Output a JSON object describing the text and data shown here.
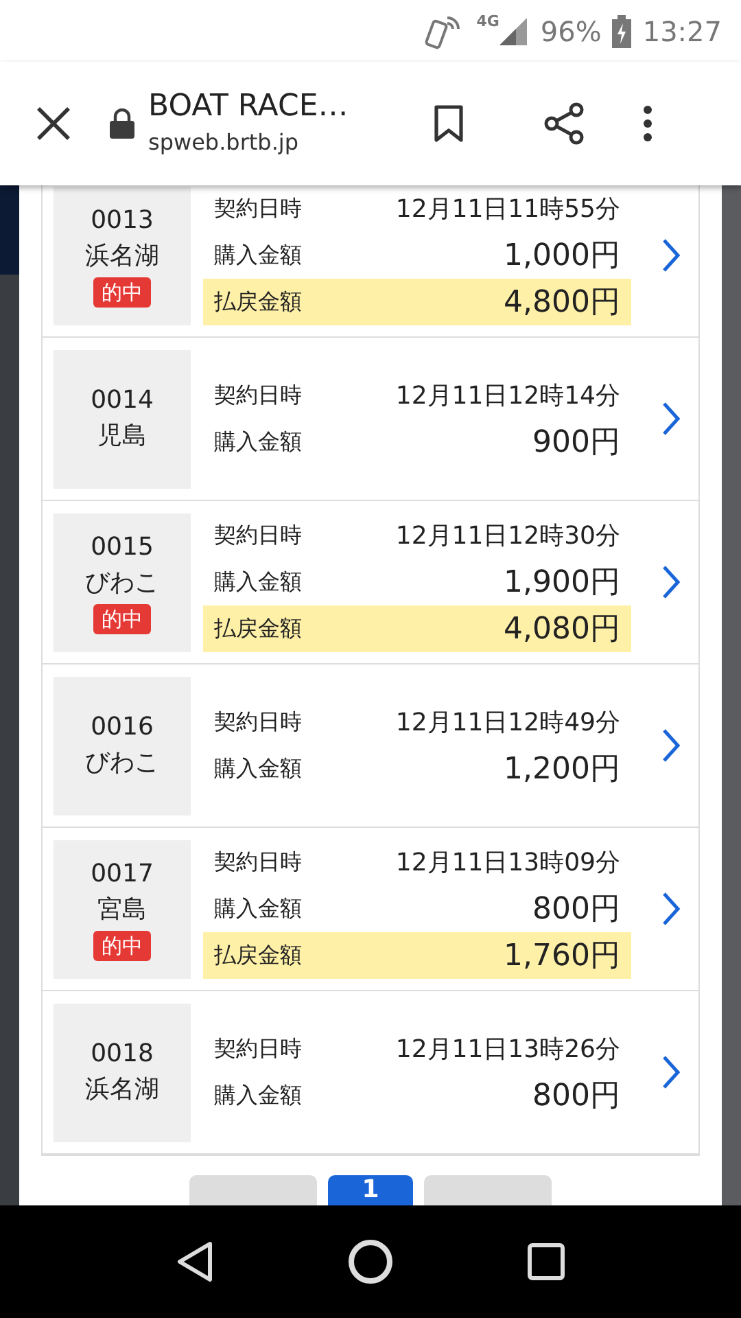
{
  "status_bar": {
    "network": "4G",
    "battery": "96%",
    "time": "13:27"
  },
  "toolbar": {
    "title": "BOAT RACE…",
    "url": "spweb.brtb.jp"
  },
  "tickets": [
    {
      "number": "0013",
      "venue": "浜名湖",
      "badge": "的中",
      "rows": [
        {
          "label": "契約日時",
          "value": "12月11日11時55分",
          "highlighted": false
        },
        {
          "label": "購入金額",
          "value": "1,000円",
          "highlighted": false
        },
        {
          "label": "払戻金額",
          "value": "4,800円",
          "highlighted": true
        }
      ]
    },
    {
      "number": "0014",
      "venue": "児島",
      "rows": [
        {
          "label": "契約日時",
          "value": "12月11日12時14分",
          "highlighted": false
        },
        {
          "label": "購入金額",
          "value": "900円",
          "highlighted": false
        }
      ]
    },
    {
      "number": "0015",
      "venue": "びわこ",
      "badge": "的中",
      "rows": [
        {
          "label": "契約日時",
          "value": "12月11日12時30分",
          "highlighted": false
        },
        {
          "label": "購入金額",
          "value": "1,900円",
          "highlighted": false
        },
        {
          "label": "払戻金額",
          "value": "4,080円",
          "highlighted": true
        }
      ]
    },
    {
      "number": "0016",
      "venue": "びわこ",
      "rows": [
        {
          "label": "契約日時",
          "value": "12月11日12時49分",
          "highlighted": false
        },
        {
          "label": "購入金額",
          "value": "1,200円",
          "highlighted": false
        }
      ]
    },
    {
      "number": "0017",
      "venue": "宮島",
      "badge": "的中",
      "rows": [
        {
          "label": "契約日時",
          "value": "12月11日13時09分",
          "highlighted": false
        },
        {
          "label": "購入金額",
          "value": "800円",
          "highlighted": false
        },
        {
          "label": "払戻金額",
          "value": "1,760円",
          "highlighted": true
        }
      ]
    },
    {
      "number": "0018",
      "venue": "浜名湖",
      "rows": [
        {
          "label": "契約日時",
          "value": "12月11日13時26分",
          "highlighted": false
        },
        {
          "label": "購入金額",
          "value": "800円",
          "highlighted": false
        }
      ]
    }
  ],
  "pagination": {
    "pages": [
      {
        "label": "1",
        "selected": true
      }
    ]
  }
}
